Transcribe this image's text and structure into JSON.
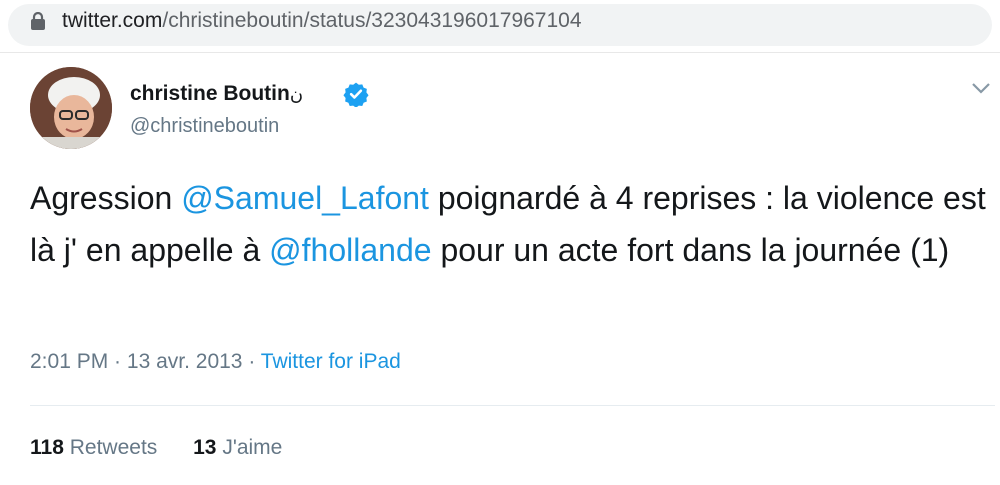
{
  "browser": {
    "url_host": "twitter.com",
    "url_path": "/christineboutin/status/323043196017967104",
    "lock_icon": "lock-icon"
  },
  "tweet": {
    "display_name": "christine Boutin",
    "name_mark": "ن",
    "handle": "@christineboutin",
    "text_parts": {
      "p1": "Agression ",
      "mention1": "@Samuel_Lafont",
      "p2": " poignardé à 4 reprises : la violence est  là j' en appelle à ",
      "mention2": "@fhollande",
      "p3": " pour un acte fort dans la journée (1)"
    },
    "time": "2:01 PM",
    "sep1": " · ",
    "date": "13 avr. 2013",
    "sep2": " · ",
    "source": "Twitter for iPad",
    "retweets_count": "118",
    "retweets_label": "Retweets",
    "likes_count": "13",
    "likes_label": "J'aime"
  },
  "colors": {
    "link": "#1b95e0",
    "muted": "#657786",
    "verified": "#1da1f2"
  }
}
